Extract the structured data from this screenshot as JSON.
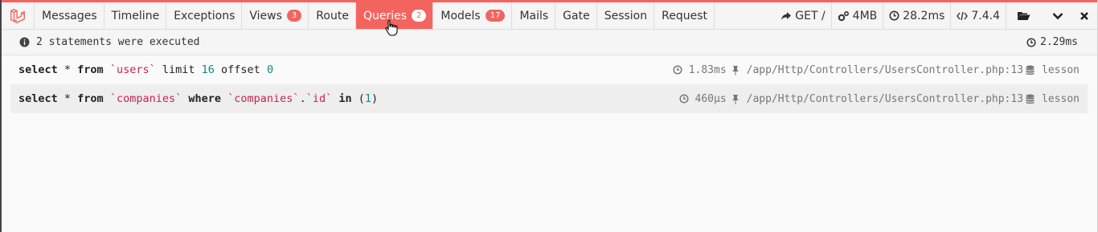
{
  "tabs": [
    {
      "label": "Messages"
    },
    {
      "label": "Timeline"
    },
    {
      "label": "Exceptions"
    },
    {
      "label": "Views",
      "badge": "3"
    },
    {
      "label": "Route"
    },
    {
      "label": "Queries",
      "badge": "2",
      "active": true
    },
    {
      "label": "Models",
      "badge": "17"
    },
    {
      "label": "Mails"
    },
    {
      "label": "Gate"
    },
    {
      "label": "Session"
    },
    {
      "label": "Request"
    }
  ],
  "right": {
    "route": "GET /",
    "memory": "4MB",
    "time": "28.2ms",
    "php": "7.4.4"
  },
  "status": {
    "message": "2 statements were executed",
    "total_time": "2.29ms"
  },
  "queries": [
    {
      "parts": [
        {
          "t": "kw",
          "v": "select"
        },
        {
          "t": "p",
          "v": " * "
        },
        {
          "t": "kw",
          "v": "from"
        },
        {
          "t": "p",
          "v": " "
        },
        {
          "t": "str",
          "v": "`users`"
        },
        {
          "t": "p",
          "v": " limit "
        },
        {
          "t": "num",
          "v": "16"
        },
        {
          "t": "p",
          "v": " offset "
        },
        {
          "t": "num",
          "v": "0"
        }
      ],
      "duration": "1.83ms",
      "source": "/app/Http/Controllers/UsersController.php:13",
      "connection": "lesson"
    },
    {
      "parts": [
        {
          "t": "kw",
          "v": "select"
        },
        {
          "t": "p",
          "v": " * "
        },
        {
          "t": "kw",
          "v": "from"
        },
        {
          "t": "p",
          "v": " "
        },
        {
          "t": "str",
          "v": "`companies`"
        },
        {
          "t": "p",
          "v": " "
        },
        {
          "t": "kw",
          "v": "where"
        },
        {
          "t": "p",
          "v": " "
        },
        {
          "t": "str",
          "v": "`companies`"
        },
        {
          "t": "p",
          "v": "."
        },
        {
          "t": "str",
          "v": "`id`"
        },
        {
          "t": "p",
          "v": " "
        },
        {
          "t": "kw",
          "v": "in"
        },
        {
          "t": "p",
          "v": " ("
        },
        {
          "t": "num",
          "v": "1"
        },
        {
          "t": "p",
          "v": ")"
        }
      ],
      "duration": "460μs",
      "source": "/app/Http/Controllers/UsersController.php:13",
      "connection": "lesson"
    }
  ],
  "colors": {
    "accent": "#f4645f"
  },
  "icons": [
    "laravel-logo-icon",
    "share-icon",
    "cogs-icon",
    "clock-icon",
    "code-icon",
    "folder-open-icon",
    "chevron-down-icon",
    "close-icon",
    "info-icon",
    "thumbtack-icon",
    "database-icon",
    "hand-cursor-icon"
  ]
}
